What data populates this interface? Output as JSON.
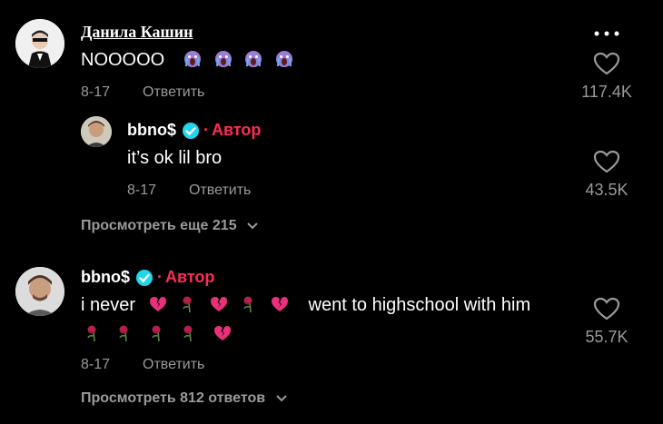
{
  "comments": [
    {
      "author": "Данила Кашин",
      "text": "NOOOOO",
      "date": "8-17",
      "reply_label": "Ответить",
      "likes": "117.4K",
      "more_icon": "more-dots-icon"
    },
    {
      "author": "bbno$",
      "badge": "Автор",
      "text": "it’s ok lil bro",
      "date": "8-17",
      "reply_label": "Ответить",
      "likes": "43.5K"
    },
    {
      "author": "bbno$",
      "badge": "Автор",
      "text_parts": [
        "i never",
        "went to highschool with him"
      ],
      "date": "8-17",
      "reply_label": "Ответить",
      "likes": "55.7K"
    }
  ],
  "view_more_1": "Просмотреть еще 215",
  "view_more_2": "Просмотреть 812 ответов",
  "colors": {
    "author_badge": "#fe2c55",
    "verified": "#20d5ec",
    "meta": "#9a9a9a",
    "background": "#000000"
  }
}
